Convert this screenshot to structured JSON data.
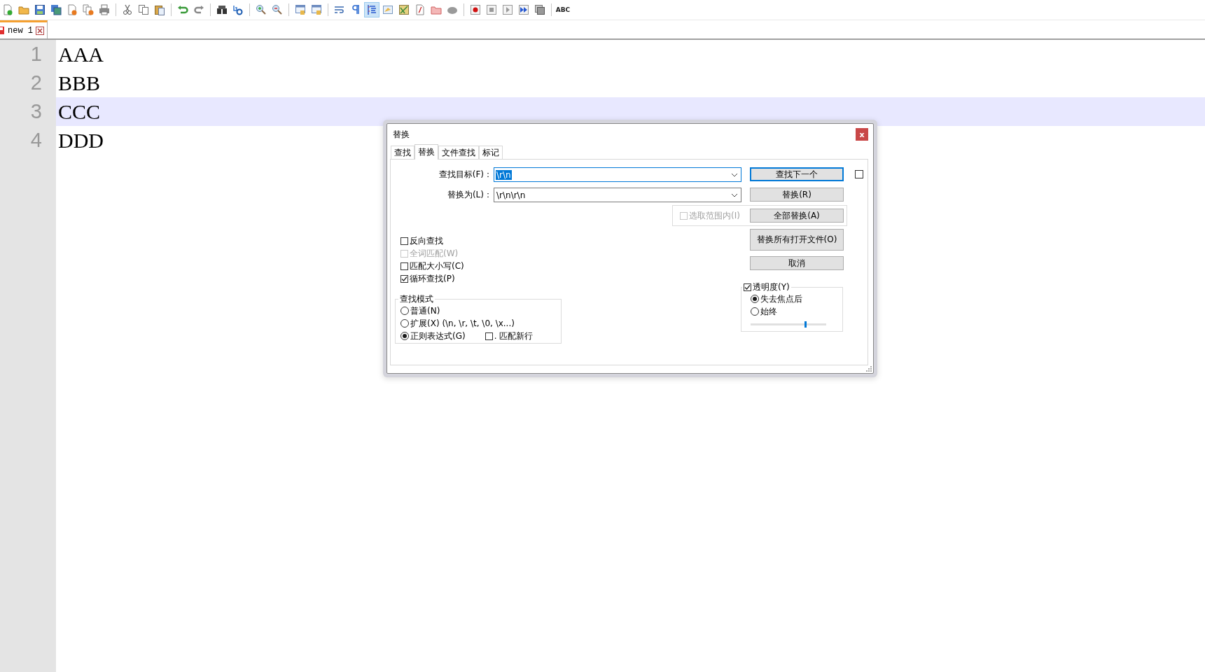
{
  "toolbar": [
    {
      "pressed": false
    },
    {
      "pressed": false
    },
    {
      "pressed": false
    },
    {
      "pressed": false
    },
    {
      "pressed": false
    },
    {
      "pressed": false
    },
    {
      "pressed": false
    },
    {
      "pressed": false
    },
    {
      "pressed": false
    },
    {
      "pressed": false
    },
    {
      "pressed": false
    },
    {
      "pressed": false
    },
    {
      "pressed": false
    },
    {
      "pressed": false
    },
    {
      "pressed": false
    },
    {
      "pressed": false
    },
    {
      "pressed": false
    },
    {
      "pressed": false
    },
    {
      "pressed": false
    },
    {
      "pressed": false
    },
    {
      "pressed": true
    },
    {
      "pressed": false
    },
    {
      "pressed": false
    },
    {
      "pressed": false
    },
    {
      "pressed": false
    },
    {
      "pressed": false
    },
    {
      "pressed": false
    },
    {
      "pressed": false
    },
    {
      "pressed": false
    },
    {
      "pressed": false
    },
    {
      "pressed": false
    },
    {
      "pressed": false,
      "label": "ABC"
    }
  ],
  "doc_tabs": [
    {
      "title": "new 1",
      "selected": true
    }
  ],
  "editor": {
    "lines": [
      {
        "number": "1",
        "text": "AAA",
        "current": false
      },
      {
        "number": "2",
        "text": "BBB",
        "current": false
      },
      {
        "number": "3",
        "text": "CCC",
        "current": true
      },
      {
        "number": "4",
        "text": "DDD",
        "current": false
      }
    ]
  },
  "dialog": {
    "title": "替换",
    "close_label": "x",
    "tabs": [
      {
        "label": "查找",
        "selected": false
      },
      {
        "label": "替换",
        "selected": true
      },
      {
        "label": "文件查找",
        "selected": false
      },
      {
        "label": "标记",
        "selected": false
      }
    ],
    "find": {
      "label": "查找目标(F)：",
      "value": "\\r\\n",
      "focused": true,
      "text_selected": true
    },
    "replace": {
      "label": "替换为(L)：",
      "value": "\\r\\n\\r\\n",
      "focused": false,
      "text_selected": false
    },
    "buttons": [
      {
        "label": "查找下一个",
        "focused": true
      },
      {
        "label": "替换(R)",
        "focused": false
      },
      {
        "label": "全部替换(A)",
        "focused": false
      },
      {
        "label": "替换所有打开文件(O)",
        "focused": false
      },
      {
        "label": "取消",
        "focused": false
      }
    ],
    "find_next_option": {
      "checked": false
    },
    "in_selection": {
      "label": "选取范围内(I)",
      "checked": false,
      "disabled": true
    },
    "options": [
      {
        "label": "反向查找",
        "checked": false,
        "disabled": false
      },
      {
        "label": "全词匹配(W)",
        "checked": false,
        "disabled": true
      },
      {
        "label": "匹配大小写(C)",
        "checked": false,
        "disabled": false
      },
      {
        "label": "循环查找(P)",
        "checked": true,
        "disabled": false
      }
    ],
    "search_mode": {
      "title": "查找模式",
      "modes": [
        {
          "label": "普通(N)",
          "selected": false
        },
        {
          "label": "扩展(X) (\\n, \\r, \\t, \\0, \\x...)",
          "selected": false
        },
        {
          "label": "正则表达式(G)",
          "selected": true
        }
      ],
      "dot_newline": {
        "label": ". 匹配新行",
        "checked": false
      }
    },
    "transparency": {
      "label": "透明度(Y)",
      "checked": true,
      "modes": [
        {
          "label": "失去焦点后",
          "selected": true
        },
        {
          "label": "始终",
          "selected": false
        }
      ],
      "level": 0.71
    }
  }
}
